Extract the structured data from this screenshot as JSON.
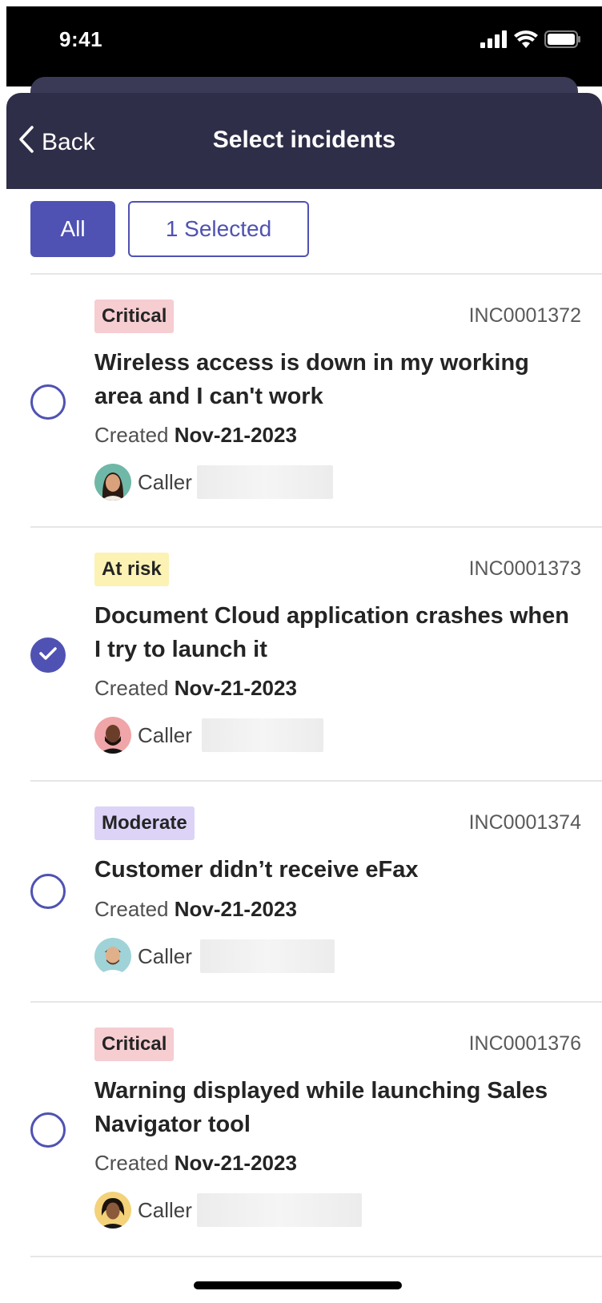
{
  "status_bar": {
    "time": "9:41"
  },
  "nav": {
    "back_label": "Back",
    "title": "Select incidents"
  },
  "filters": {
    "all_label": "All",
    "selected_label": "1 Selected",
    "active": "All"
  },
  "incidents": [
    {
      "priority": "Critical",
      "number": "INC0001372",
      "title": "Wireless access is down in my working area and I can't work",
      "created_label": "Created",
      "created_date": "Nov-21-2023",
      "caller_label": "Caller",
      "selected": false
    },
    {
      "priority": "At risk",
      "number": "INC0001373",
      "title": "Document Cloud application crashes when I try to launch it",
      "created_label": "Created",
      "created_date": "Nov-21-2023",
      "caller_label": "Caller",
      "selected": true
    },
    {
      "priority": "Moderate",
      "number": "INC0001374",
      "title": "Customer didn’t receive eFax",
      "created_label": "Created",
      "created_date": "Nov-21-2023",
      "caller_label": "Caller",
      "selected": false
    },
    {
      "priority": "Critical",
      "number": "INC0001376",
      "title": "Warning displayed while launching Sales Navigator tool",
      "created_label": "Created",
      "created_date": "Nov-21-2023",
      "caller_label": "Caller",
      "selected": false
    }
  ],
  "colors": {
    "brand": "#4f52b2",
    "header": "#2e2e48",
    "critical": "#f6cdd1",
    "at_risk": "#fbf2b4",
    "moderate": "#dcd3f7"
  }
}
